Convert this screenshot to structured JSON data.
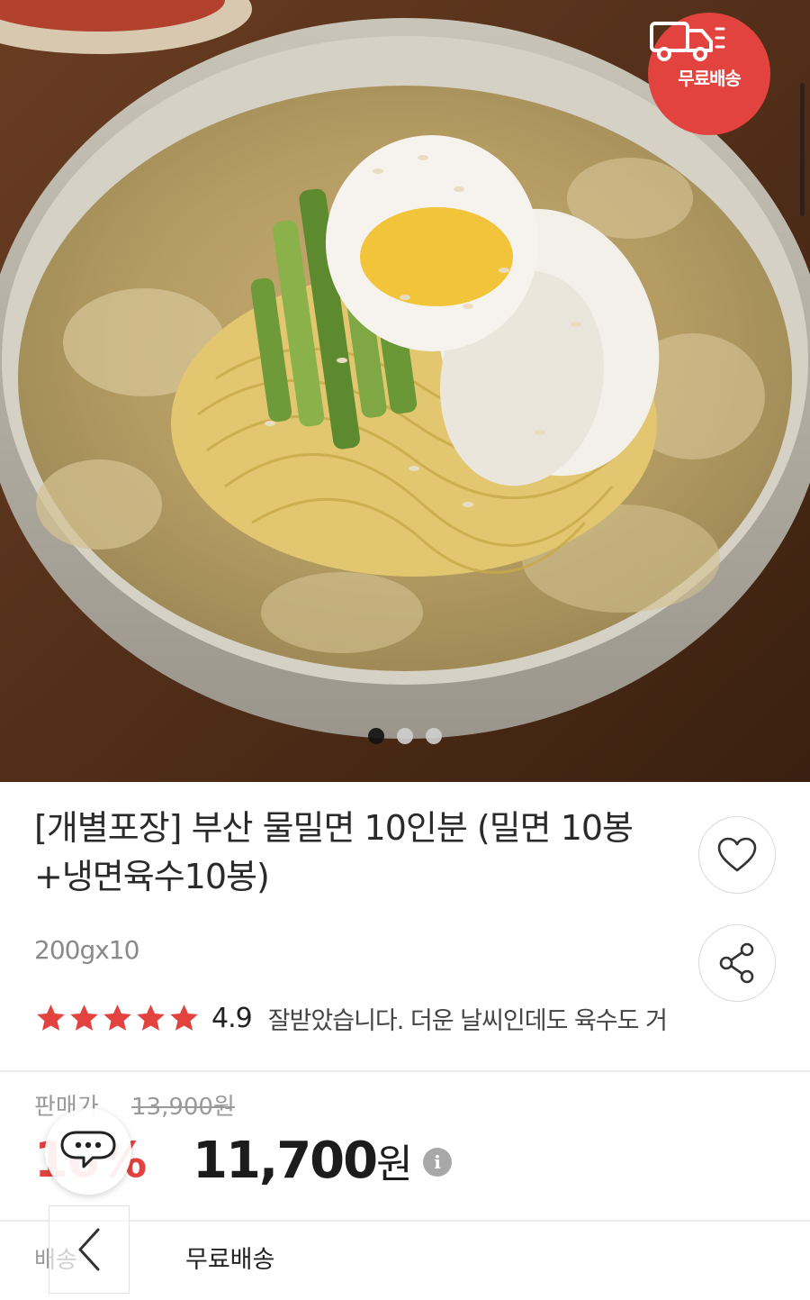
{
  "hero": {
    "badge_text": "무료배송",
    "badge_icon": "truck-icon",
    "carousel_total": 3,
    "carousel_active": 1
  },
  "product": {
    "title": "[개별포장] 부산 물밀면 10인분 (밀면 10봉+냉면육수10봉)",
    "weight": "200gx10",
    "rating_score": "4.9",
    "stars_filled": 5,
    "review_snippet": "잘받았습니다. 더운 날씨인데도 육수도 거"
  },
  "price": {
    "label": "판매가",
    "original": "13,900원",
    "discount": "16%",
    "sale_amount": "11,700",
    "sale_unit": "원",
    "info_glyph": "i"
  },
  "shipping": {
    "label": "배송",
    "value": "무료배송"
  },
  "colors": {
    "accent": "#e2433f",
    "text": "#222222",
    "muted": "#9a9a9a"
  }
}
